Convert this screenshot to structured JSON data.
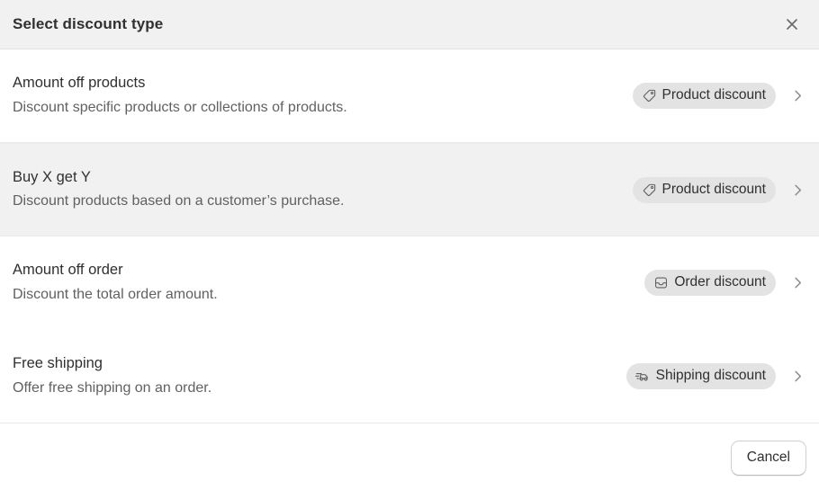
{
  "header": {
    "title": "Select discount type",
    "close_icon": "close-icon"
  },
  "options": [
    {
      "title": "Amount off products",
      "description": "Discount specific products or collections of products.",
      "badge_label": "Product discount",
      "badge_icon": "price-tag-icon",
      "chevron_icon": "chevron-right-icon",
      "hovered": false
    },
    {
      "title": "Buy X get Y",
      "description": "Discount products based on a customer’s purchase.",
      "badge_label": "Product discount",
      "badge_icon": "price-tag-icon",
      "chevron_icon": "chevron-right-icon",
      "hovered": true
    },
    {
      "title": "Amount off order",
      "description": "Discount the total order amount.",
      "badge_label": "Order discount",
      "badge_icon": "inbox-icon",
      "chevron_icon": "chevron-right-icon",
      "hovered": false
    },
    {
      "title": "Free shipping",
      "description": "Offer free shipping on an order.",
      "badge_label": "Shipping discount",
      "badge_icon": "delivery-truck-icon",
      "chevron_icon": "chevron-right-icon",
      "hovered": false
    }
  ],
  "footer": {
    "cancel_label": "Cancel"
  },
  "colors": {
    "header_bg": "#f1f1f1",
    "row_hover_bg": "#f1f1f1",
    "badge_bg": "#e3e3e3",
    "text_primary": "#303030",
    "text_secondary": "#616161",
    "divider": "#ebebeb"
  }
}
